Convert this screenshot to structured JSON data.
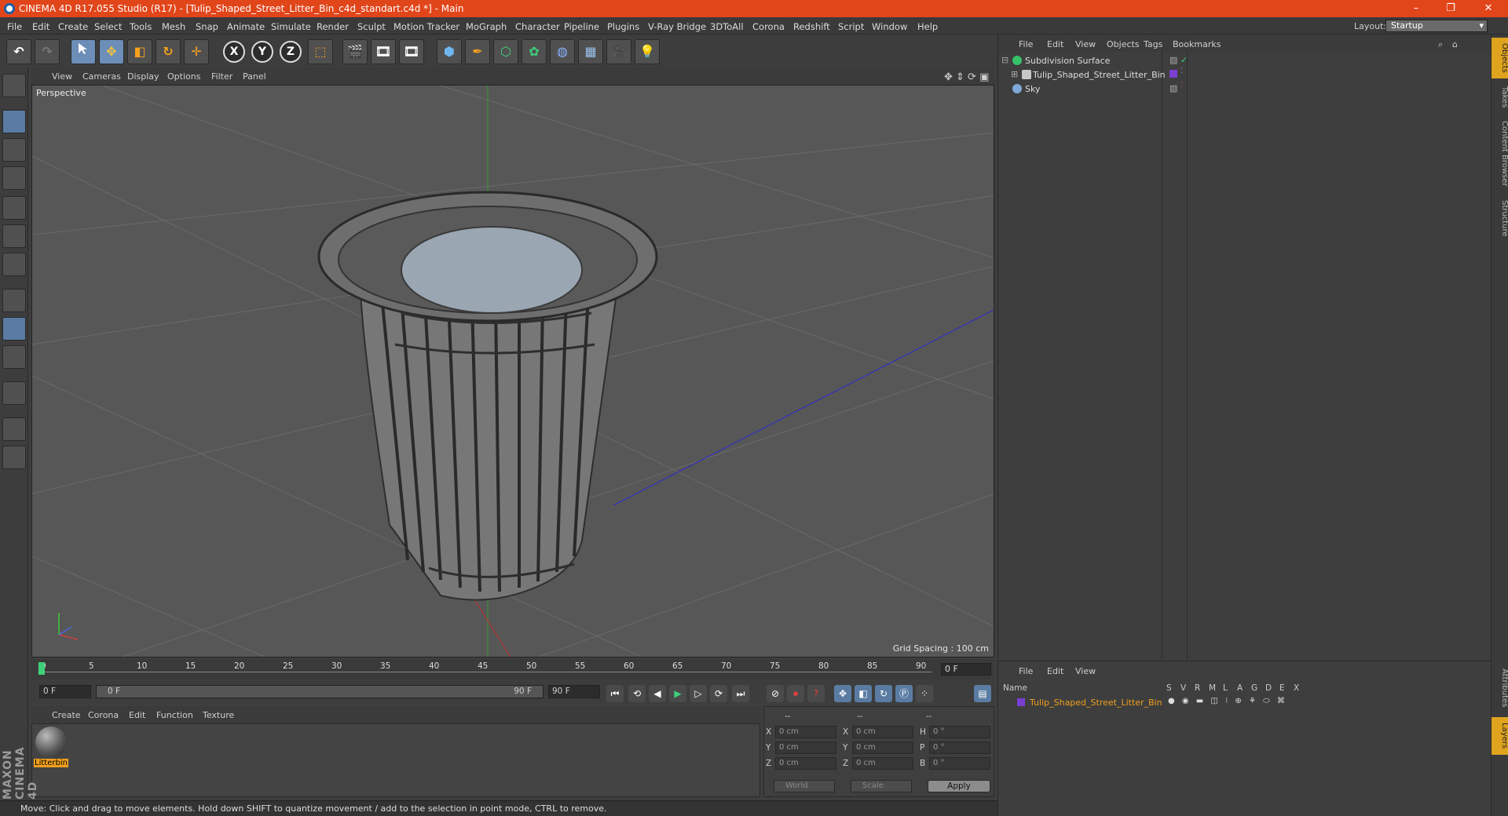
{
  "window": {
    "title": "CINEMA 4D R17.055 Studio (R17) - [Tulip_Shaped_Street_Litter_Bin_c4d_standart.c4d *] - Main",
    "min": "–",
    "max": "❐",
    "close": "✕"
  },
  "menu": [
    "File",
    "Edit",
    "Create",
    "Select",
    "Tools",
    "Mesh",
    "Snap",
    "Animate",
    "Simulate",
    "Render",
    "Sculpt",
    "Motion Tracker",
    "MoGraph",
    "Character",
    "Pipeline",
    "Plugins",
    "V-Ray Bridge",
    "3DToAll",
    "Corona",
    "Redshift",
    "Script",
    "Window",
    "Help"
  ],
  "layout": {
    "label": "Layout:",
    "value": "Startup"
  },
  "toolbar": {
    "undo": "↶",
    "redo": "↷",
    "axis_x": "X",
    "axis_y": "Y",
    "axis_z": "Z"
  },
  "viewport": {
    "menu": [
      "View",
      "Cameras",
      "Display",
      "Options",
      "Filter",
      "Panel"
    ],
    "label": "Perspective",
    "grid_spacing": "Grid Spacing : 100 cm"
  },
  "timeline": {
    "ticks": [
      "0",
      "5",
      "10",
      "15",
      "20",
      "25",
      "30",
      "35",
      "40",
      "45",
      "50",
      "55",
      "60",
      "65",
      "70",
      "75",
      "80",
      "85",
      "90"
    ],
    "current_frame": "0 F"
  },
  "playbar": {
    "start": "0 F",
    "range_start": "0 F",
    "range_end": "90 F",
    "end": "90 F"
  },
  "materials": {
    "menu": [
      "Create",
      "Corona",
      "Edit",
      "Function",
      "Texture"
    ],
    "items": [
      {
        "name": "Litterbin"
      }
    ]
  },
  "coords": {
    "header": [
      "--",
      "--",
      "--"
    ],
    "rows": [
      {
        "a": "X",
        "av": "0 cm",
        "b": "X",
        "bv": "0 cm",
        "c": "H",
        "cv": "0 °"
      },
      {
        "a": "Y",
        "av": "0 cm",
        "b": "Y",
        "bv": "0 cm",
        "c": "P",
        "cv": "0 °"
      },
      {
        "a": "Z",
        "av": "0 cm",
        "b": "Z",
        "bv": "0 cm",
        "c": "B",
        "cv": "0 °"
      }
    ],
    "mode": "World",
    "type": "Scale",
    "apply": "Apply"
  },
  "objects": {
    "menu": [
      "File",
      "Edit",
      "View",
      "Objects",
      "Tags",
      "Bookmarks"
    ],
    "items": [
      {
        "name": "Subdivision Surface",
        "color": "#35c06a"
      },
      {
        "name": "Tulip_Shaped_Street_Litter_Bin",
        "color": "#c8c8c8"
      },
      {
        "name": "Sky",
        "color": "#7fa9d8"
      }
    ]
  },
  "layers": {
    "menu": [
      "File",
      "Edit",
      "View"
    ],
    "columns": [
      "Name",
      "S",
      "V",
      "R",
      "M",
      "L",
      "A",
      "G",
      "D",
      "E",
      "X"
    ],
    "rows": [
      {
        "name": "Tulip_Shaped_Street_Litter_Bin",
        "color": "#7a3fd0"
      }
    ]
  },
  "right_tabs": [
    "Objects",
    "Takes",
    "Content Browser",
    "Structure",
    "Attributes",
    "Layers"
  ],
  "status": "Move: Click and drag to move elements. Hold down SHIFT to quantize movement / add to the selection in point mode, CTRL to remove.",
  "branding": "MAXON CINEMA 4D"
}
